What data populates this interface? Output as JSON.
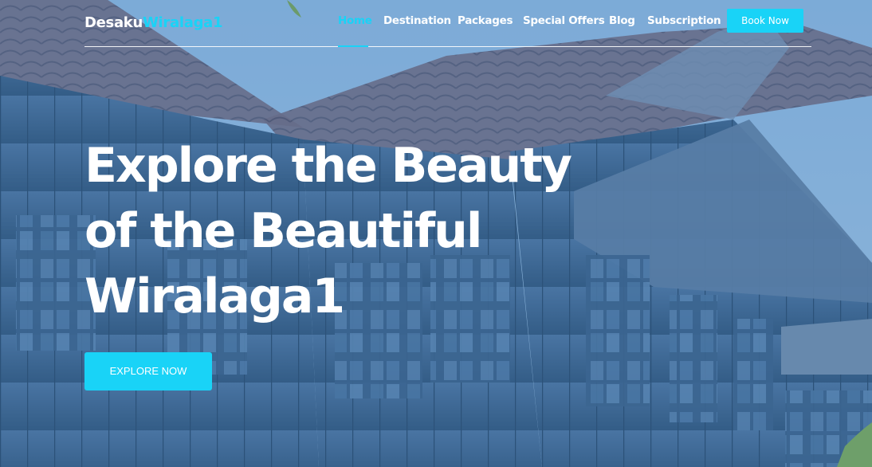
{
  "brand": {
    "name_part1": "Desaku",
    "name_part2": "Wiralaga1"
  },
  "nav": {
    "items": [
      {
        "label": "Home",
        "active": true
      },
      {
        "label": "Destination",
        "active": false
      },
      {
        "label": "Packages",
        "active": false
      },
      {
        "label": "Special Offers",
        "active": false
      },
      {
        "label": "Blog",
        "active": false
      },
      {
        "label": "Subscription",
        "active": false
      }
    ],
    "cta_label": "Book Now"
  },
  "hero": {
    "headline_lines": [
      "Explore the Beauty",
      "of the Beautiful",
      "Wiralaga1"
    ],
    "cta_label": "EXPLORE NOW"
  },
  "colors": {
    "accent": "#19d3f7",
    "text": "#ffffff",
    "overlay": "#4a7eb0"
  }
}
